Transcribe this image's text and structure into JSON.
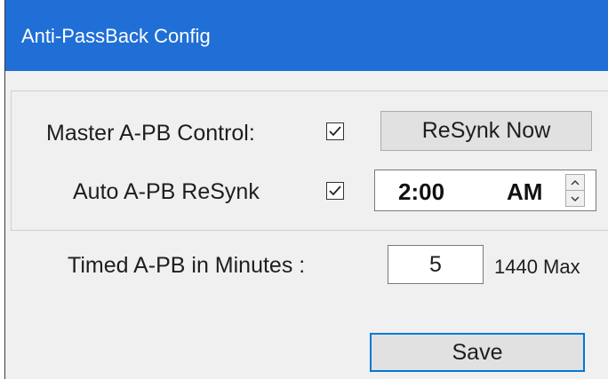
{
  "window": {
    "title": "Anti-PassBack Config"
  },
  "master": {
    "label": "Master A-PB Control:",
    "checked": true,
    "button_label": "ReSynk Now"
  },
  "auto": {
    "label": "Auto A-PB ReSynk",
    "checked": true,
    "time": "2:00",
    "ampm": "AM"
  },
  "timed": {
    "label": "Timed A-PB in Minutes :",
    "value": "5",
    "max_label": "1440 Max"
  },
  "save_label": "Save",
  "icons": {
    "checkbox": "check-icon",
    "spin_up": "chevron-up-icon",
    "spin_down": "chevron-down-icon"
  }
}
